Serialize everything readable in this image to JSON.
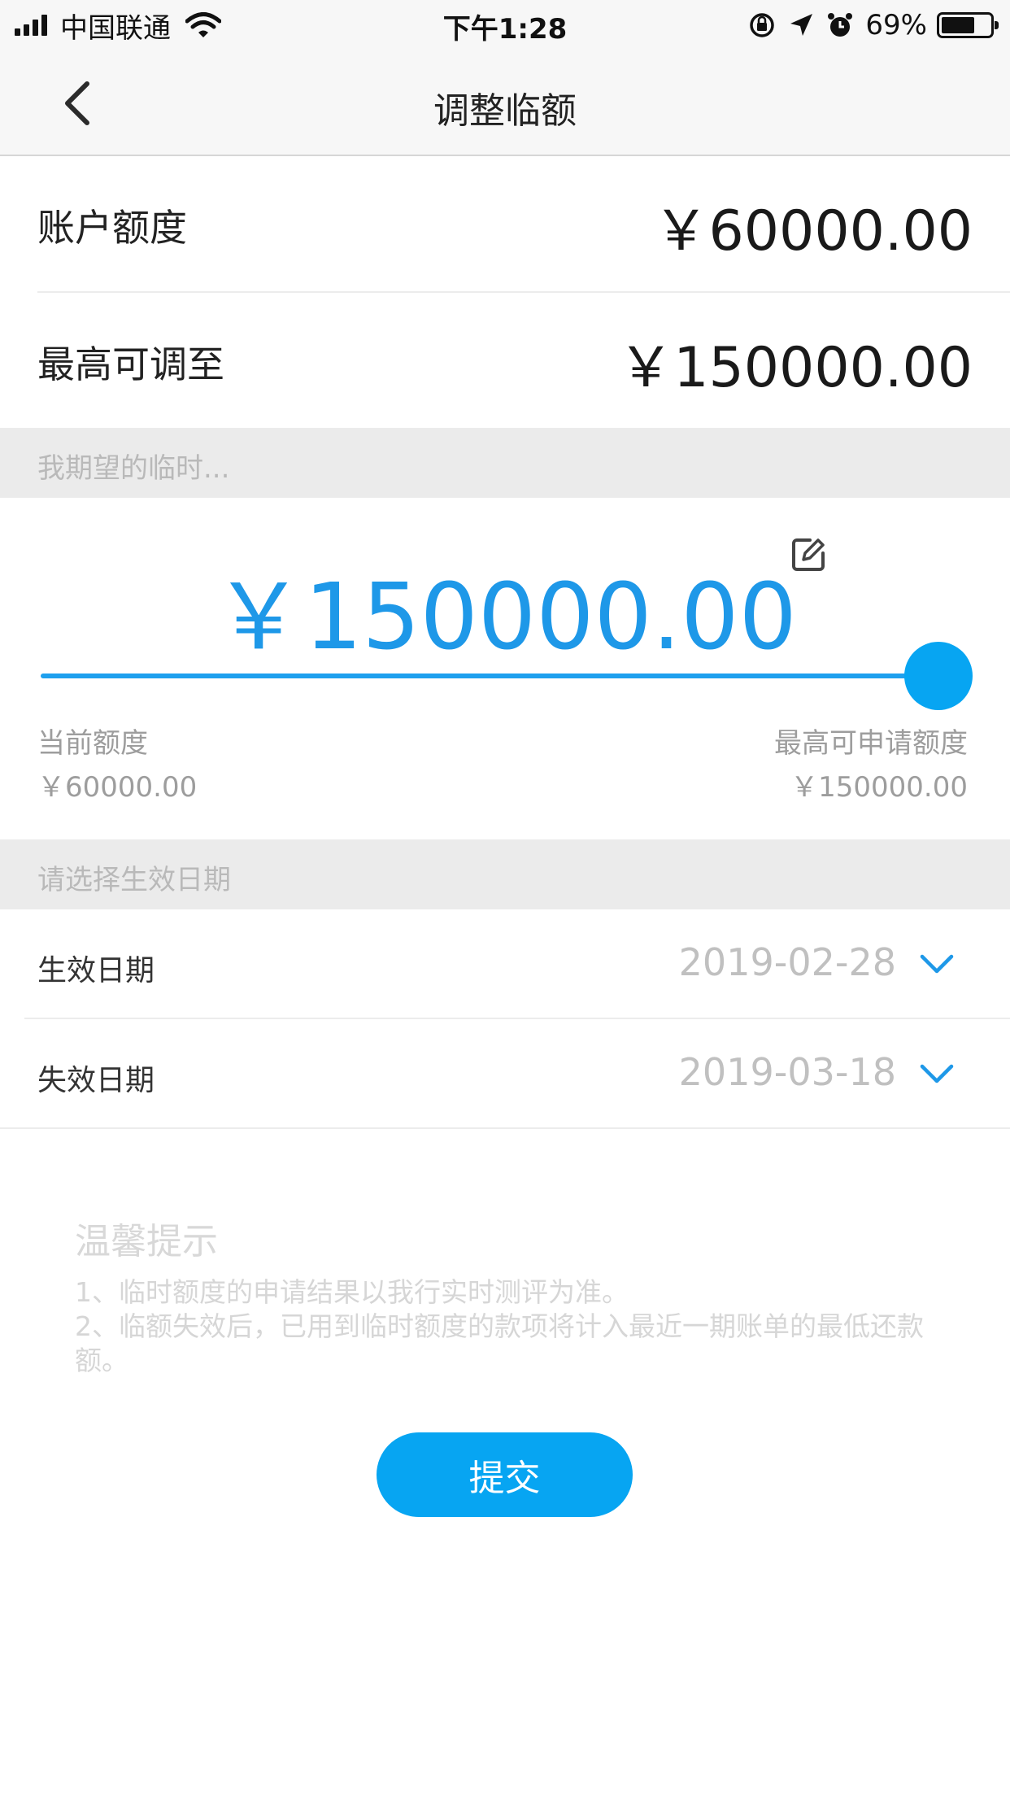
{
  "status_bar": {
    "carrier": "中国联通",
    "time": "下午1:28",
    "battery": "69%",
    "battery_level": 0.69,
    "icons": [
      "signal-icon",
      "wifi-icon",
      "orientation-lock-icon",
      "location-icon",
      "alarm-icon",
      "battery-icon"
    ]
  },
  "nav": {
    "title": "调整临额",
    "back_icon": "chevron-left-icon"
  },
  "account": {
    "limit_label": "账户额度",
    "limit_value": "￥60000.00",
    "max_label": "最高可调至",
    "max_value": "￥150000.00"
  },
  "expect_section": {
    "header": "我期望的临时...",
    "amount": "￥150000.00",
    "edit_icon": "edit-icon",
    "slider_fraction": 1.0,
    "current_label": "当前额度",
    "current_value": "￥60000.00",
    "max_label": "最高可申请额度",
    "max_value": "￥150000.00"
  },
  "date_section": {
    "header": "请选择生效日期",
    "effective_label": "生效日期",
    "effective_value": "2019-02-28",
    "expire_label": "失效日期",
    "expire_value": "2019-03-18"
  },
  "tips": {
    "title": "温馨提示",
    "items": [
      "1、临时额度的申请结果以我行实时测评为准。",
      "2、临额失效后，已用到临时额度的款项将计入最近一期账单的最低还款额。"
    ]
  },
  "submit": {
    "label": "提交"
  },
  "colors": {
    "accent": "#07a5f2",
    "amount_blue": "#1e98e8",
    "section_bg": "#ebebeb"
  }
}
